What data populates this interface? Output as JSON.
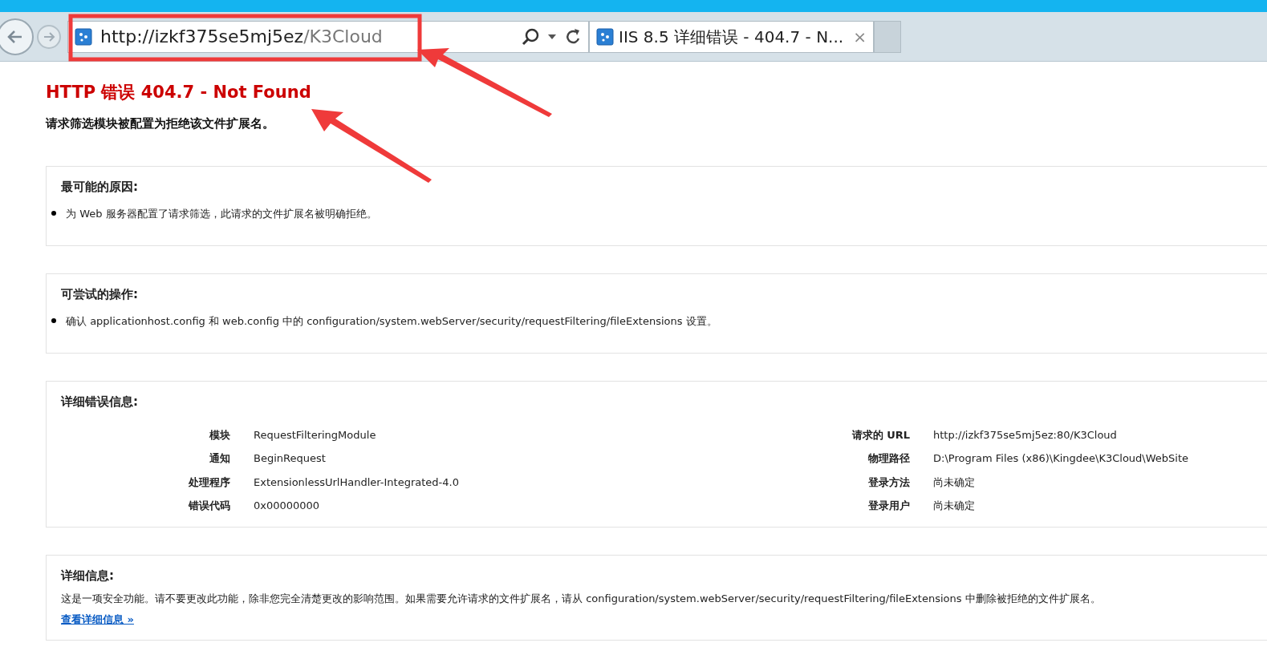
{
  "browser": {
    "address": {
      "host": "http://izkf375se5mj5ez",
      "path": "/K3Cloud"
    },
    "tabs": [
      {
        "title": "IIS 8.5 详细错误 - 404.7 - N...",
        "close": "×",
        "selected": true
      }
    ]
  },
  "page": {
    "title": "HTTP 错误 404.7 - Not Found",
    "subtitle": "请求筛选模块被配置为拒绝该文件扩展名。",
    "sections": [
      {
        "kind": "list",
        "heading": "最可能的原因:",
        "items": [
          "为 Web 服务器配置了请求筛选，此请求的文件扩展名被明确拒绝。"
        ]
      },
      {
        "kind": "list",
        "heading": "可尝试的操作:",
        "items": [
          "确认 applicationhost.config 和 web.config 中的 configuration/system.webServer/security/requestFiltering/fileExtensions 设置。"
        ]
      },
      {
        "kind": "details",
        "heading": "详细错误信息:",
        "left": [
          {
            "label": "模块",
            "value": "RequestFilteringModule"
          },
          {
            "label": "通知",
            "value": "BeginRequest"
          },
          {
            "label": "处理程序",
            "value": "ExtensionlessUrlHandler-Integrated-4.0"
          },
          {
            "label": "错误代码",
            "value": "0x00000000"
          }
        ],
        "right": [
          {
            "label": "请求的 URL",
            "value": "http://izkf375se5mj5ez:80/K3Cloud"
          },
          {
            "label": "物理路径",
            "value": "D:\\Program Files (x86)\\Kingdee\\K3Cloud\\WebSite"
          },
          {
            "label": "登录方法",
            "value": "尚未确定"
          },
          {
            "label": "登录用户",
            "value": "尚未确定"
          }
        ]
      },
      {
        "kind": "text",
        "heading": "详细信息:",
        "text": "这是一项安全功能。请不要更改此功能，除非您完全清楚更改的影响范围。如果需要允许请求的文件扩展名，请从 configuration/system.webServer/security/requestFiltering/fileExtensions 中删除被拒绝的文件扩展名。",
        "link": "查看详细信息 »"
      }
    ]
  }
}
